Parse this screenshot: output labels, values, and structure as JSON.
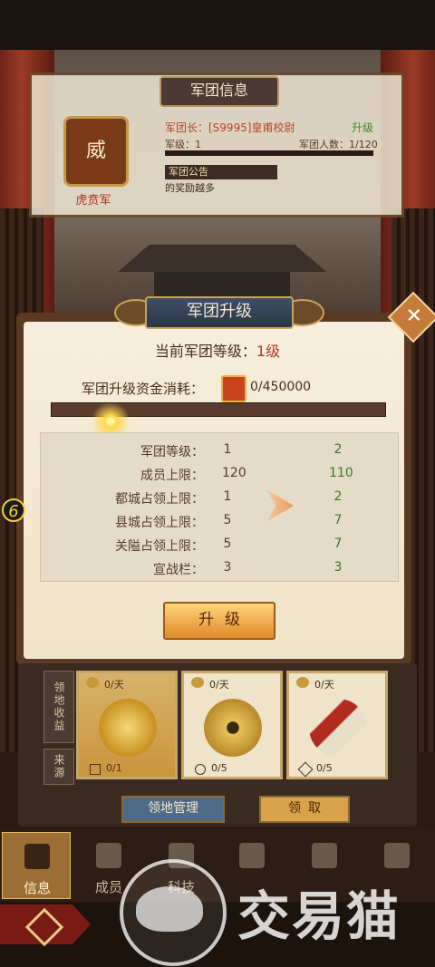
{
  "info_panel": {
    "title": "军团信息",
    "emblem_char": "威",
    "legion_name": "虎贲军",
    "leader": "军团长：[S9995]皇甫校尉",
    "upgrade_link": "升级",
    "level_label": "军级：1",
    "members_label": "军团人数：1/120",
    "notice_tab": "军团公告",
    "notice_text": "的奖励越多"
  },
  "dialog": {
    "title": "军团升级",
    "current_level_label": "当前军团等级：",
    "current_level_value": "1级",
    "cost_label": "军团升级资金消耗：",
    "cost_value": "0/450000",
    "progress_fraction": 0,
    "stats": [
      {
        "name": "军团等级：",
        "cur": "1",
        "next": "2"
      },
      {
        "name": "成员上限：",
        "cur": "120",
        "next": "110"
      },
      {
        "name": "都城占领上限：",
        "cur": "1",
        "next": "2"
      },
      {
        "name": "县城占领上限：",
        "cur": "5",
        "next": "7"
      },
      {
        "name": "关隘占领上限：",
        "cur": "5",
        "next": "7"
      },
      {
        "name": "宣战栏：",
        "cur": "3",
        "next": "3"
      }
    ],
    "upgrade_button": "升级",
    "close_icon": "close-icon"
  },
  "side_badge": "6",
  "territory": {
    "tab_income": "领地收益",
    "tab_source": "来源",
    "cards": [
      {
        "rate": "0/天",
        "count": "0/1",
        "icon": "gold-ingots"
      },
      {
        "rate": "0/天",
        "count": "0/5",
        "icon": "copper-coin"
      },
      {
        "rate": "0/天",
        "count": "0/5",
        "icon": "war-horn"
      }
    ],
    "manage_button": "领地管理",
    "collect_button": "领取"
  },
  "nav": [
    {
      "label": "信息",
      "active": true
    },
    {
      "label": "成员",
      "active": false
    },
    {
      "label": "科技",
      "active": false
    },
    {
      "label": "",
      "active": false
    },
    {
      "label": "",
      "active": false
    },
    {
      "label": "",
      "active": false
    }
  ],
  "watermark": "交易猫",
  "colors": {
    "accent_gold": "#e08a2a",
    "stat_next_green": "#3a7a22",
    "level_red": "#b0391f"
  }
}
